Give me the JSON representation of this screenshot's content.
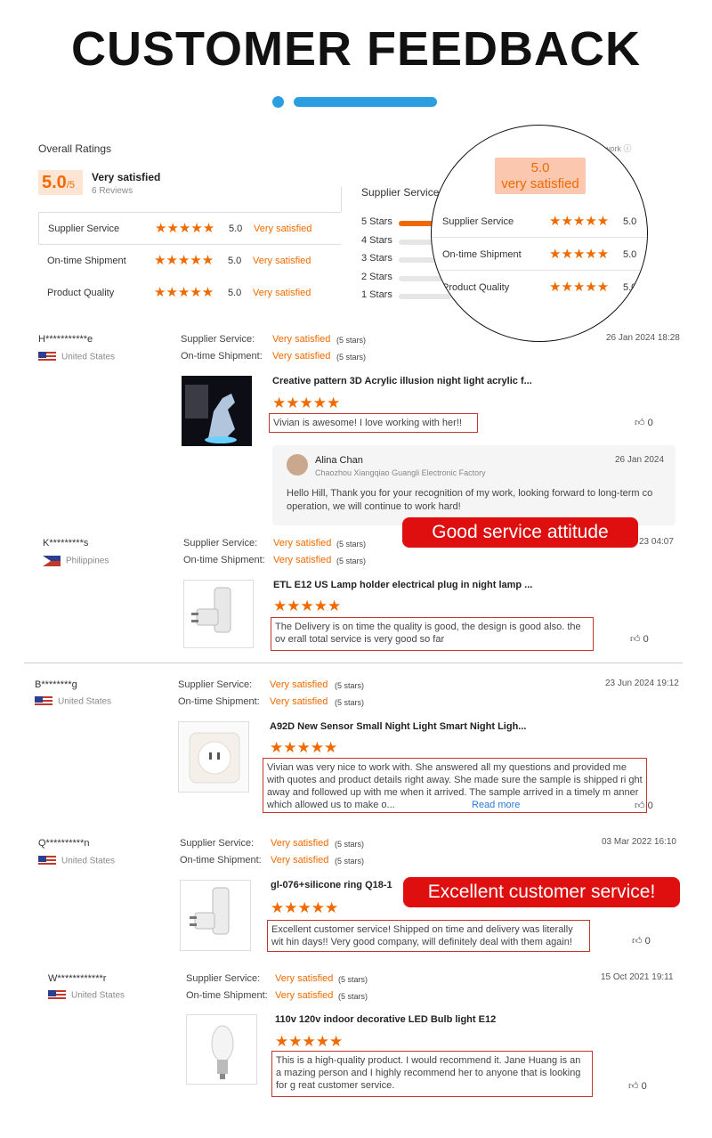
{
  "header": {
    "title": "CUSTOMER FEEDBACK"
  },
  "overall": {
    "heading": "Overall Ratings",
    "score": "5.0",
    "score_suffix": "/5",
    "label": "Very satisfied",
    "reviews": "6 Reviews",
    "rating_value": 5,
    "top_right_note": "s work"
  },
  "categories": [
    {
      "label": "Supplier Service",
      "stars": "★★★★★",
      "score": "5.0",
      "sat": "Very satisfied"
    },
    {
      "label": "On-time Shipment",
      "stars": "★★★★★",
      "score": "5.0",
      "sat": "Very satisfied"
    },
    {
      "label": "Product Quality",
      "stars": "★★★★★",
      "score": "5.0",
      "sat": "Very satisfied"
    }
  ],
  "distribution": {
    "heading": "Supplier Service",
    "rows": [
      {
        "label": "5 Stars",
        "fraction": 1.0
      },
      {
        "label": "4 Stars",
        "fraction": 0
      },
      {
        "label": "3 Stars",
        "fraction": 0
      },
      {
        "label": "2 Stars",
        "fraction": 0
      },
      {
        "label": "1 Stars",
        "fraction": 0
      }
    ]
  },
  "magnifier": {
    "highlight_line1": "5.0",
    "highlight_line2": "very satisfied",
    "rows": [
      {
        "label": "Supplier Service",
        "stars": "★★★★★",
        "score": "5.0"
      },
      {
        "label": "On-time Shipment",
        "stars": "★★★★★",
        "score": "5.0"
      },
      {
        "label": "Product Quality",
        "stars": "★★★★★",
        "score": "5.0"
      }
    ]
  },
  "labels": {
    "supplier_service": "Supplier Service:",
    "ontime_shipment": "On-time Shipment:",
    "very_satisfied": "Very satisfied",
    "five_stars": "(5 stars)",
    "stars": "★★★★★",
    "read_more": "Read more"
  },
  "reviews": [
    {
      "name": "H***********e",
      "country": "United States",
      "flag": "us",
      "date": "26 Jan 2024 18:28",
      "product": "Creative pattern 3D Acrylic illusion night light acrylic f...",
      "text": "Vivian is awesome! I love working with her!!",
      "likes": "0"
    },
    {
      "name": "K*********s",
      "country": "Philippines",
      "flag": "ph",
      "date": "23 04:07",
      "product": "ETL E12 US Lamp holder electrical plug in night lamp ...",
      "text": "The Delivery is on time the quality is good, the design is good also. the ov erall total service is very good so far",
      "likes": "0"
    },
    {
      "name": "B********g",
      "country": "United States",
      "flag": "us",
      "date": "23 Jun 2024 19:12",
      "product": "A92D New Sensor Small Night Light Smart Night Ligh...",
      "text": "Vivian was very nice to work with.  She answered all my questions and provided me with quotes and product details right away.  She made sure the sample is shipped ri ght away and followed up with me when it arrived.  The sample arrived in a timely m anner which allowed us to make o...",
      "likes": "0"
    },
    {
      "name": "Q**********n",
      "country": "United States",
      "flag": "us",
      "date": "03 Mar 2022 16:10",
      "product": "gl-076+silicone ring Q18-1",
      "text": "Excellent customer service! Shipped on time and delivery was literally wit hin days!! Very good company, will definitely deal with them again!",
      "likes": "0"
    },
    {
      "name": "W************r",
      "country": "United States",
      "flag": "us",
      "date": "15 Oct 2021 19:11",
      "product": "110v 120v indoor decorative LED Bulb light E12",
      "text": "This is a high-quality product. I would recommend it. Jane Huang is an a mazing person and I highly recommend her to anyone that is looking for g reat customer service.",
      "likes": "0"
    }
  ],
  "reply": {
    "name": "Alina Chan",
    "company": "Chaozhou Xiangqiao Guangli Electronic Factory",
    "date": "26 Jan 2024",
    "text": "Hello Hill,  Thank you for your recognition of my work, looking forward to long-term co operation, we will continue to work hard!"
  },
  "banners": {
    "good_service": "Good service attitude",
    "excellent": "Excellent customer service!"
  },
  "colors": {
    "accent": "#f06a00",
    "blue": "#2a9ee0",
    "red_banner": "#e00f0f"
  }
}
